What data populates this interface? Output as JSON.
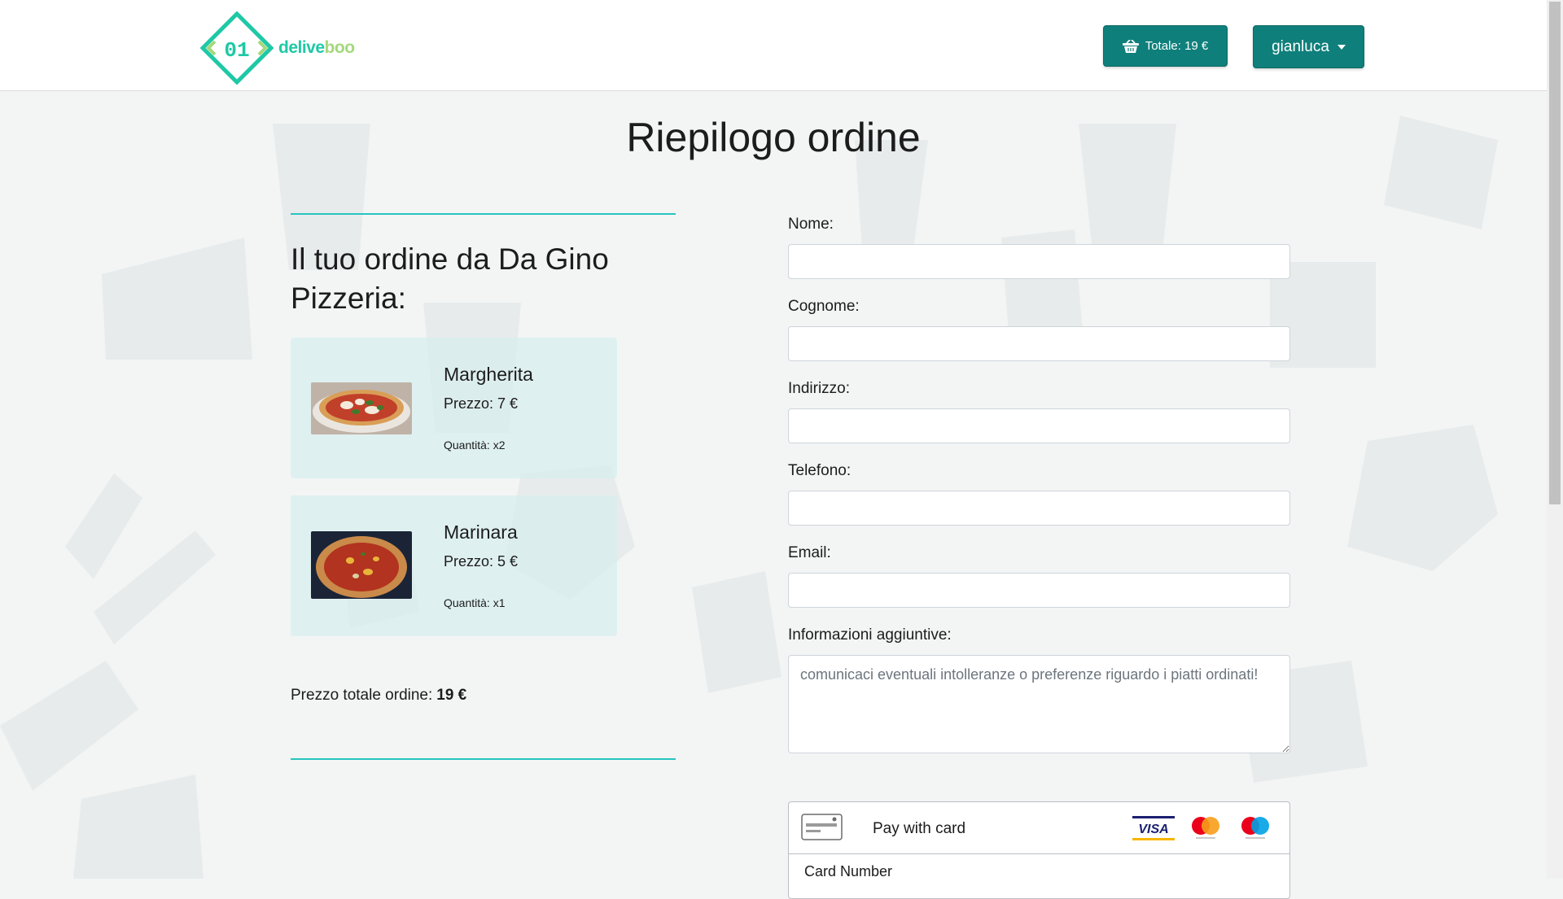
{
  "navbar": {
    "logo": {
      "mark_text": "01",
      "brand_part1": "delive",
      "brand_part2": "boo"
    },
    "cart_button": {
      "icon": "basket-icon",
      "label": "Totale: 19 €"
    },
    "user_menu": {
      "label": "gianluca",
      "icon": "caret-down-icon"
    }
  },
  "page": {
    "title": "Riepilogo ordine"
  },
  "order": {
    "heading": "Il tuo ordine da Da Gino Pizzeria:",
    "items": [
      {
        "name": "Margherita",
        "price": "Prezzo: 7 €",
        "quantity": "Quantità: x2"
      },
      {
        "name": "Marinara",
        "price": "Prezzo: 5 €",
        "quantity": "Quantità: x1"
      }
    ],
    "total_label": "Prezzo totale ordine:",
    "total_value": "19 €"
  },
  "form": {
    "nome_label": "Nome:",
    "nome_value": "",
    "cognome_label": "Cognome:",
    "cognome_value": "",
    "indirizzo_label": "Indirizzo:",
    "indirizzo_value": "",
    "telefono_label": "Telefono:",
    "telefono_value": "",
    "email_label": "Email:",
    "email_value": "",
    "info_label": "Informazioni aggiuntive:",
    "info_placeholder": "comunicaci eventuali intolleranze o preferenze riguardo i piatti ordinati!"
  },
  "payment": {
    "title": "Pay with card",
    "card_number_label": "Card Number",
    "brands": [
      "visa",
      "mastercard",
      "maestro"
    ],
    "icon": "credit-card-icon"
  },
  "colors": {
    "primary": "#0f7f7b",
    "accent_line": "#27c4c0",
    "logo_teal": "#1fc8a6",
    "logo_green": "#a4d87c",
    "card_bg": "#d8eeee",
    "page_bg": "#f3f5f5"
  }
}
